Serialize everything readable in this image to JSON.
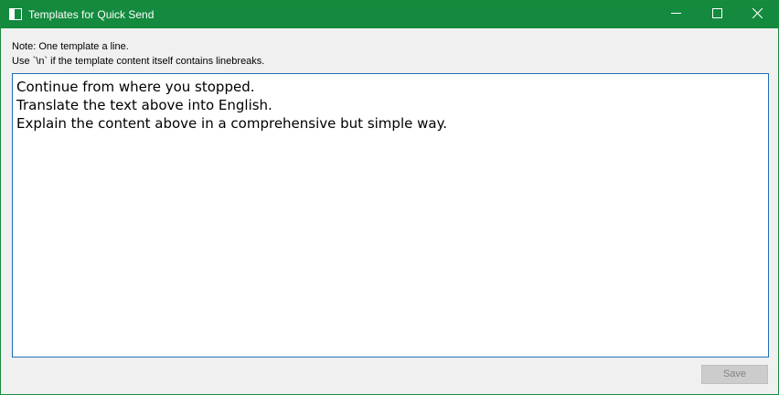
{
  "window": {
    "title": "Templates for Quick Send",
    "icon": "window-panel-icon",
    "controls": {
      "minimize_icon": "minimize-icon",
      "maximize_icon": "maximize-icon",
      "close_icon": "close-icon"
    }
  },
  "note": {
    "line1": "Note: One template a line.",
    "line2": "Use `\\n` if the template content itself contains linebreaks."
  },
  "editor": {
    "lines": [
      "Continue from where you stopped.",
      "Translate the text above into English.",
      "Explain the content above in a comprehensive but simple way."
    ]
  },
  "footer": {
    "save_label": "Save",
    "save_enabled": false
  },
  "colors": {
    "titlebar": "#138a3e",
    "editor_border": "#1f6fb5",
    "window_background": "#f0f0f0"
  }
}
